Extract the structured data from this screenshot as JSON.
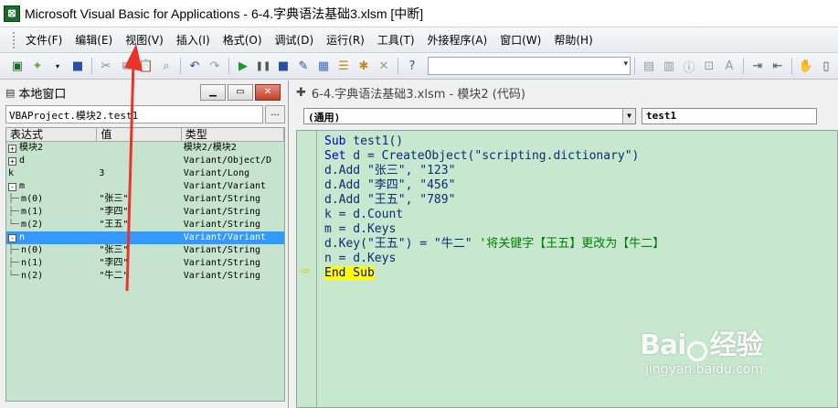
{
  "window": {
    "title": "Microsoft Visual Basic for Applications - 6-4.字典语法基础3.xlsm [中断]"
  },
  "menu": {
    "items": [
      "文件(F)",
      "编辑(E)",
      "视图(V)",
      "插入(I)",
      "格式(O)",
      "调试(D)",
      "运行(R)",
      "工具(T)",
      "外接程序(A)",
      "窗口(W)",
      "帮助(H)"
    ]
  },
  "toolbar": {
    "combo_value": ""
  },
  "locals": {
    "title": "本地窗口",
    "context": "VBAProject.模块2.test1",
    "context_button": "...",
    "headers": [
      "表达式",
      "值",
      "类型"
    ],
    "rows": [
      {
        "expr": "模块2",
        "value": "",
        "type": "模块2/模块2",
        "expander": "+",
        "tree": "",
        "selected": false
      },
      {
        "expr": "d",
        "value": "",
        "type": "Variant/Object/D",
        "expander": "+",
        "tree": "",
        "selected": false
      },
      {
        "expr": "k",
        "value": "3",
        "type": "Variant/Long",
        "expander": "",
        "tree": "",
        "selected": false
      },
      {
        "expr": "m",
        "value": "",
        "type": "Variant/Variant",
        "expander": "-",
        "tree": "",
        "selected": false
      },
      {
        "expr": "m(0)",
        "value": "\"张三\"",
        "type": "Variant/String",
        "expander": "",
        "tree": "├─",
        "selected": false
      },
      {
        "expr": "m(1)",
        "value": "\"李四\"",
        "type": "Variant/String",
        "expander": "",
        "tree": "├─",
        "selected": false
      },
      {
        "expr": "m(2)",
        "value": "\"王五\"",
        "type": "Variant/String",
        "expander": "",
        "tree": "└─",
        "selected": false
      },
      {
        "expr": "n",
        "value": "",
        "type": "Variant/Variant",
        "expander": "-",
        "tree": "",
        "selected": true
      },
      {
        "expr": "n(0)",
        "value": "\"张三\"",
        "type": "Variant/String",
        "expander": "",
        "tree": "├─",
        "selected": false
      },
      {
        "expr": "n(1)",
        "value": "\"李四\"",
        "type": "Variant/String",
        "expander": "",
        "tree": "├─",
        "selected": false
      },
      {
        "expr": "n(2)",
        "value": "\"牛二\"",
        "type": "Variant/String",
        "expander": "",
        "tree": "└─",
        "selected": false
      }
    ]
  },
  "code_window": {
    "title": "6-4.字典语法基础3.xlsm - 模块2 (代码)",
    "object_dropdown": "(通用)",
    "proc_dropdown": "test1",
    "lines": [
      [
        {
          "t": "Sub",
          "k": "kw"
        },
        {
          "t": " test1()",
          "k": ""
        }
      ],
      [
        {
          "t": "Set",
          "k": "kw"
        },
        {
          "t": " d = CreateObject(\"scripting.dictionary\")",
          "k": ""
        }
      ],
      [
        {
          "t": "d.Add \"张三\", \"123\"",
          "k": ""
        }
      ],
      [
        {
          "t": "d.Add \"李四\", \"456\"",
          "k": ""
        }
      ],
      [
        {
          "t": "d.Add \"王五\", \"789\"",
          "k": ""
        }
      ],
      [
        {
          "t": "k = d.Count",
          "k": ""
        }
      ],
      [
        {
          "t": "m = d.Keys",
          "k": ""
        }
      ],
      [
        {
          "t": "d.Key(\"王五\") = \"牛二\" ",
          "k": ""
        },
        {
          "t": "'将关键字【王五】更改为【牛二】",
          "k": "cm"
        }
      ],
      [
        {
          "t": "n = d.Keys",
          "k": ""
        }
      ],
      [
        {
          "t": "End Sub",
          "k": "kw hl"
        }
      ]
    ]
  },
  "watermark": {
    "brand_left": "Bai",
    "brand_right": "经验",
    "url": "jingyan.baidu.com"
  },
  "colors": {
    "editor_bg": "#c7e8cf",
    "selection": "#3399ff",
    "current_line": "#ffff00",
    "arrow": "#e8352a"
  }
}
